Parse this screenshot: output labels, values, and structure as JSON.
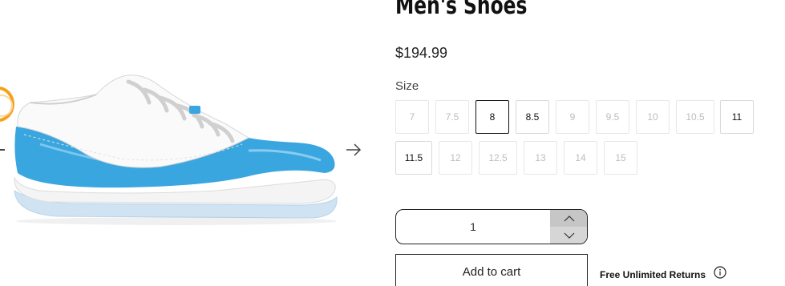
{
  "product": {
    "title": "Men's Shoes",
    "price": "$194.99",
    "size_label": "Size",
    "sizes": [
      {
        "label": "7",
        "state": "unavailable"
      },
      {
        "label": "7.5",
        "state": "unavailable"
      },
      {
        "label": "8",
        "state": "selected"
      },
      {
        "label": "8.5",
        "state": "available"
      },
      {
        "label": "9",
        "state": "unavailable"
      },
      {
        "label": "9.5",
        "state": "unavailable"
      },
      {
        "label": "10",
        "state": "unavailable"
      },
      {
        "label": "10.5",
        "state": "unavailable"
      },
      {
        "label": "11",
        "state": "available"
      },
      {
        "label": "11.5",
        "state": "available"
      },
      {
        "label": "12",
        "state": "unavailable"
      },
      {
        "label": "12.5",
        "state": "unavailable"
      },
      {
        "label": "13",
        "state": "unavailable"
      },
      {
        "label": "14",
        "state": "unavailable"
      },
      {
        "label": "15",
        "state": "unavailable"
      }
    ],
    "quantity": "1",
    "add_to_cart_label": "Add to cart",
    "returns_label": "Free Unlimited Returns"
  },
  "colors": {
    "shoe_blue": "#3aa6df",
    "thumb_ring": "#f5a21a"
  },
  "icons": {
    "next": "arrow-right-icon",
    "prev": "arrow-left-icon",
    "qty_up": "chevron-up-icon",
    "qty_down": "chevron-down-icon",
    "info": "info-icon"
  }
}
